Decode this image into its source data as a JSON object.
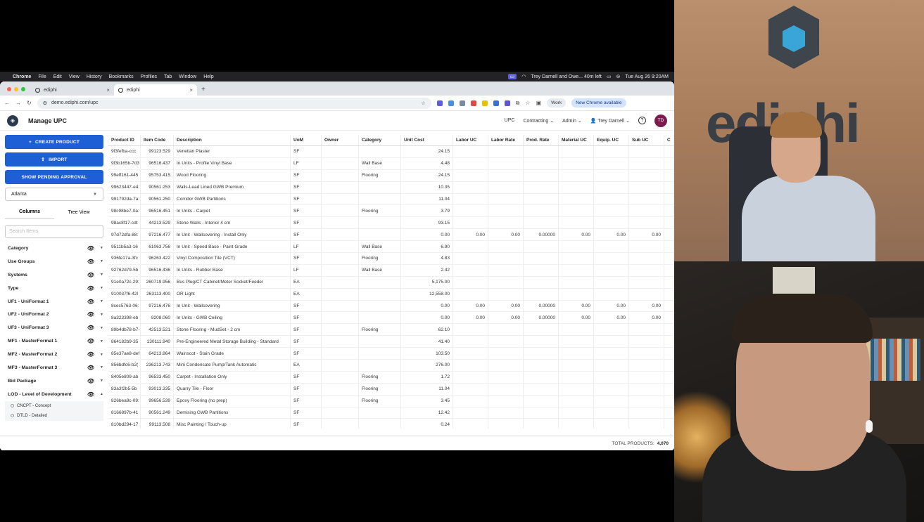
{
  "mac_menubar": {
    "apple": "",
    "app": "Chrome",
    "menus": [
      "File",
      "Edit",
      "View",
      "History",
      "Bookmarks",
      "Profiles",
      "Tab",
      "Window",
      "Help"
    ],
    "meeting": "Trey Darnell and Owe... 40m left",
    "datetime": "Tue Aug 26 9:20AM"
  },
  "browser": {
    "tabs": [
      {
        "label": "ediphi",
        "active": false
      },
      {
        "label": "ediphi",
        "active": true
      }
    ],
    "url": "demo.ediphi.com/upc",
    "profile": "Work",
    "update_notice": "New Chrome available"
  },
  "app": {
    "logo": "◈",
    "title": "Manage UPC",
    "nav": {
      "upc": "UPC",
      "contracting": "Contracting",
      "admin": "Admin",
      "user": "Trey Darnell",
      "avatar": "TD"
    }
  },
  "sidebar": {
    "create_label": "CREATE PRODUCT",
    "import_label": "IMPORT",
    "pending_label": "SHOW PENDING APPROVAL",
    "location": "Atlanta",
    "view_tabs": [
      "Columns",
      "Tree View"
    ],
    "search_placeholder": "Search Items",
    "filters": [
      "Category",
      "Use Groups",
      "Systems",
      "Type",
      "UF1 - UniFormat 1",
      "UF2 - UniFormat 2",
      "UF3 - UniFormat 3",
      "MF1 - MasterFormat 1",
      "MF2 - MasterFormat 2",
      "MF3 - MasterFormat 3",
      "Bid Package",
      "LOD - Level of Development"
    ],
    "lod_options": [
      "CNCPT - Concept",
      "DTLD - Detailed"
    ]
  },
  "table": {
    "headers": [
      "Product ID",
      "Item Code",
      "Description",
      "UoM",
      "Owner",
      "Category",
      "Unit Cost",
      "Labor UC",
      "Labor Rate",
      "Prod. Rate",
      "Material UC",
      "Equip. UC",
      "Sub UC",
      "C"
    ],
    "rows": [
      [
        "9f3fefba-ccc",
        "99123.529",
        "Venetian Plaster",
        "SF",
        "",
        "",
        "24.15",
        "",
        "",
        "",
        "",
        "",
        ""
      ],
      [
        "9f3b165b-7d3",
        "96516.437",
        "In Units - Profile Vinyl Base",
        "LF",
        "",
        "Wall Base",
        "4.48",
        "",
        "",
        "",
        "",
        "",
        ""
      ],
      [
        "99eff161-445",
        "95753.415",
        "Wood Flooring",
        "SF",
        "",
        "Flooring",
        "24.15",
        "",
        "",
        "",
        "",
        "",
        ""
      ],
      [
        "99623447-e4:",
        "90561.253",
        "Walls-Lead Lined GWB Premium",
        "SF",
        "",
        "",
        "10.35",
        "",
        "",
        "",
        "",
        "",
        ""
      ],
      [
        "991792da-7a:",
        "90561.250",
        "Corridor GWB Partitions",
        "SF",
        "",
        "",
        "11.04",
        "",
        "",
        "",
        "",
        "",
        ""
      ],
      [
        "98c98be7-0a:",
        "96516.451",
        "In Units - Carpet",
        "SF",
        "",
        "Flooring",
        "3.79",
        "",
        "",
        "",
        "",
        "",
        ""
      ],
      [
        "98ac8f17-cdt",
        "44213.529",
        "Stone Walls - Interior 4 cm",
        "SF",
        "",
        "",
        "93.15",
        "",
        "",
        "",
        "",
        "",
        ""
      ],
      [
        "97d72dfa-88:",
        "97216.477",
        "In Unit - Wallcovering - Install Only",
        "SF",
        "",
        "",
        "0.00",
        "0.00",
        "0.00",
        "0.00000",
        "0.00",
        "0.00",
        "0.00"
      ],
      [
        "9511b5a3-16",
        "61063.756",
        "In Unit - Speed Base - Paint Grade",
        "LF",
        "",
        "Wall Base",
        "6.90",
        "",
        "",
        "",
        "",
        "",
        ""
      ],
      [
        "936fe17a-3fc",
        "96263.422",
        "Vinyl Composition Tile (VCT)",
        "SF",
        "",
        "Flooring",
        "4.83",
        "",
        "",
        "",
        "",
        "",
        ""
      ],
      [
        "92762d79-5b",
        "96516.436",
        "In Units - Rubber Base",
        "LF",
        "",
        "Wall Base",
        "2.42",
        "",
        "",
        "",
        "",
        "",
        ""
      ],
      [
        "91e0a72c-29:",
        "260719.956",
        "Bus Plug/CT Cabinet/Meter Socket/Feeder",
        "EA",
        "",
        "",
        "5,175.00",
        "",
        "",
        "",
        "",
        "",
        ""
      ],
      [
        "910037f6-42l",
        "263113.400",
        "OR Light",
        "EA",
        "",
        "",
        "12,558.00",
        "",
        "",
        "",
        "",
        "",
        ""
      ],
      [
        "8cec5763-06:",
        "97216.476",
        "In Unit - Wallcovering",
        "SF",
        "",
        "",
        "0.00",
        "0.00",
        "0.00",
        "0.00000",
        "0.00",
        "0.00",
        "0.00"
      ],
      [
        "8a323398-eb",
        "9208.060",
        "In Units - GWB Ceiling",
        "SF",
        "",
        "",
        "0.00",
        "0.00",
        "0.00",
        "0.00000",
        "0.00",
        "0.00",
        "0.00"
      ],
      [
        "89b4db78-b7-",
        "42513.521",
        "Stone Flooring - MudSet - 2 cm",
        "SF",
        "",
        "Flooring",
        "62.10",
        "",
        "",
        "",
        "",
        "",
        ""
      ],
      [
        "864182b9-35",
        "130111.940",
        "Pre-Engineered Metal Storage Building - Standard",
        "SF",
        "",
        "",
        "41.40",
        "",
        "",
        "",
        "",
        "",
        ""
      ],
      [
        "85e37ae8-def",
        "64213.864",
        "Wainscot - Stain Grade",
        "SF",
        "",
        "",
        "103.50",
        "",
        "",
        "",
        "",
        "",
        ""
      ],
      [
        "856bdfc6-b2(",
        "236213.743",
        "Mini Condensate Pump/Tank Automatic",
        "EA",
        "",
        "",
        "276.00",
        "",
        "",
        "",
        "",
        "",
        ""
      ],
      [
        "8405e809-ab",
        "96533.450",
        "Carpet - Installation Only",
        "SF",
        "",
        "Flooring",
        "1.72",
        "",
        "",
        "",
        "",
        "",
        ""
      ],
      [
        "83a3f2b5-5b",
        "93013.335",
        "Quarry Tile - Floor",
        "SF",
        "",
        "Flooring",
        "11.04",
        "",
        "",
        "",
        "",
        "",
        ""
      ],
      [
        "826bea9c-09:",
        "99656.539",
        "Epoxy Flooring (no prep)",
        "SF",
        "",
        "Flooring",
        "3.45",
        "",
        "",
        "",
        "",
        "",
        ""
      ],
      [
        "8166897b-41",
        "90561.249",
        "Demising GWB Partitions",
        "SF",
        "",
        "",
        "12.42",
        "",
        "",
        "",
        "",
        "",
        ""
      ],
      [
        "810bd294-17",
        "99113.508",
        "Misc Painting / Touch-up",
        "SF",
        "",
        "",
        "0.24",
        "",
        "",
        "",
        "",
        "",
        ""
      ]
    ]
  },
  "footer": {
    "label": "TOTAL PRODUCTS:",
    "count": "4,070"
  },
  "video": {
    "wall_logo": "ediphi"
  },
  "colors": {
    "primary": "#1e5fd6",
    "avatar": "#7b1b4f"
  }
}
